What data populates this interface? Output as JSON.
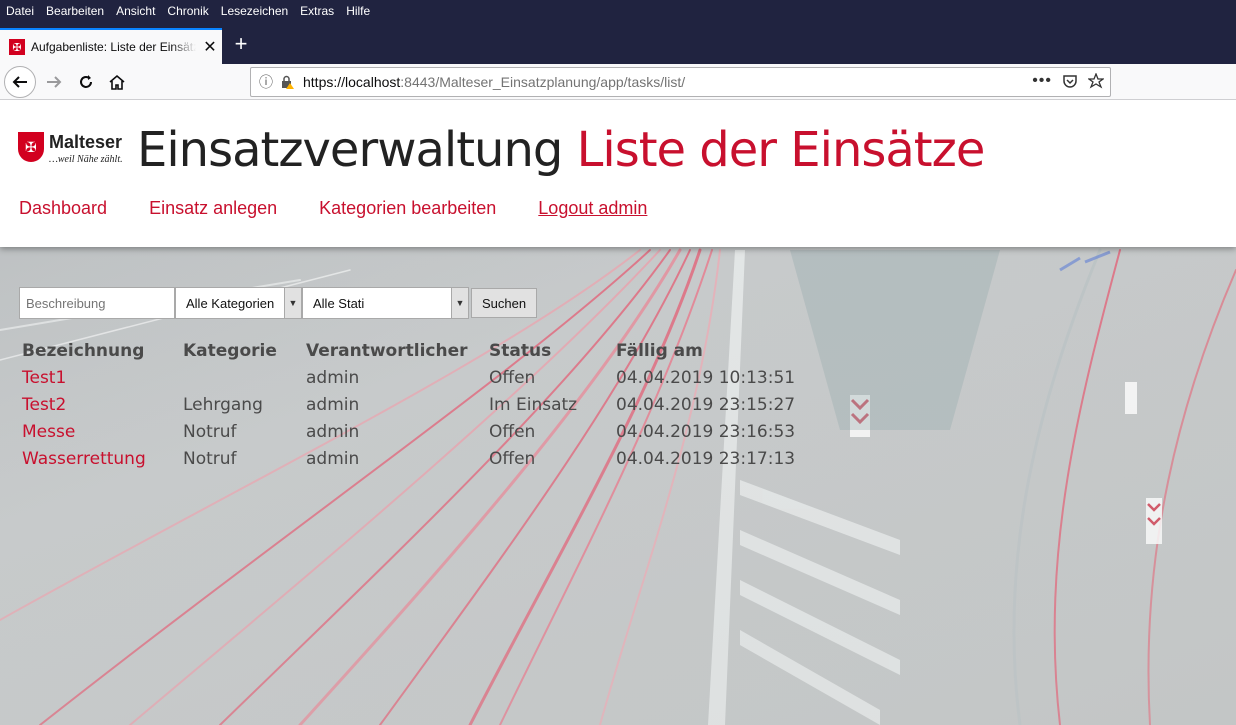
{
  "browser": {
    "menu": [
      "Datei",
      "Bearbeiten",
      "Ansicht",
      "Chronik",
      "Lesezeichen",
      "Extras",
      "Hilfe"
    ],
    "tab_title": "Aufgabenliste: Liste der Einsätze",
    "url_host": "https://localhost",
    "url_rest": ":8443/Malteser_Einsatzplanung/app/tasks/list/"
  },
  "header": {
    "logo_name": "Malteser",
    "logo_tagline": "…weil Nähe zählt.",
    "title_main": "Einsatzverwaltung",
    "title_sub": "Liste der Einsätze",
    "nav": [
      "Dashboard",
      "Einsatz anlegen",
      "Kategorien bearbeiten",
      "Logout admin"
    ]
  },
  "filters": {
    "search_placeholder": "Beschreibung",
    "category_selected": "Alle Kategorien",
    "status_selected": "Alle Stati",
    "submit_label": "Suchen"
  },
  "table": {
    "headers": [
      "Bezeichnung",
      "Kategorie",
      "Verantwortlicher",
      "Status",
      "Fällig am"
    ],
    "rows": [
      [
        "Test1",
        "",
        "admin",
        "Offen",
        "04.04.2019 10:13:51"
      ],
      [
        "Test2",
        "Lehrgang",
        "admin",
        "Im Einsatz",
        "04.04.2019 23:15:27"
      ],
      [
        "Messe",
        "Notruf",
        "admin",
        "Offen",
        "04.04.2019 23:16:53"
      ],
      [
        "Wasserrettung",
        "Notruf",
        "admin",
        "Offen",
        "04.04.2019 23:17:13"
      ]
    ]
  },
  "colors": {
    "brand_red": "#c8102e",
    "titlebar": "#202340"
  }
}
